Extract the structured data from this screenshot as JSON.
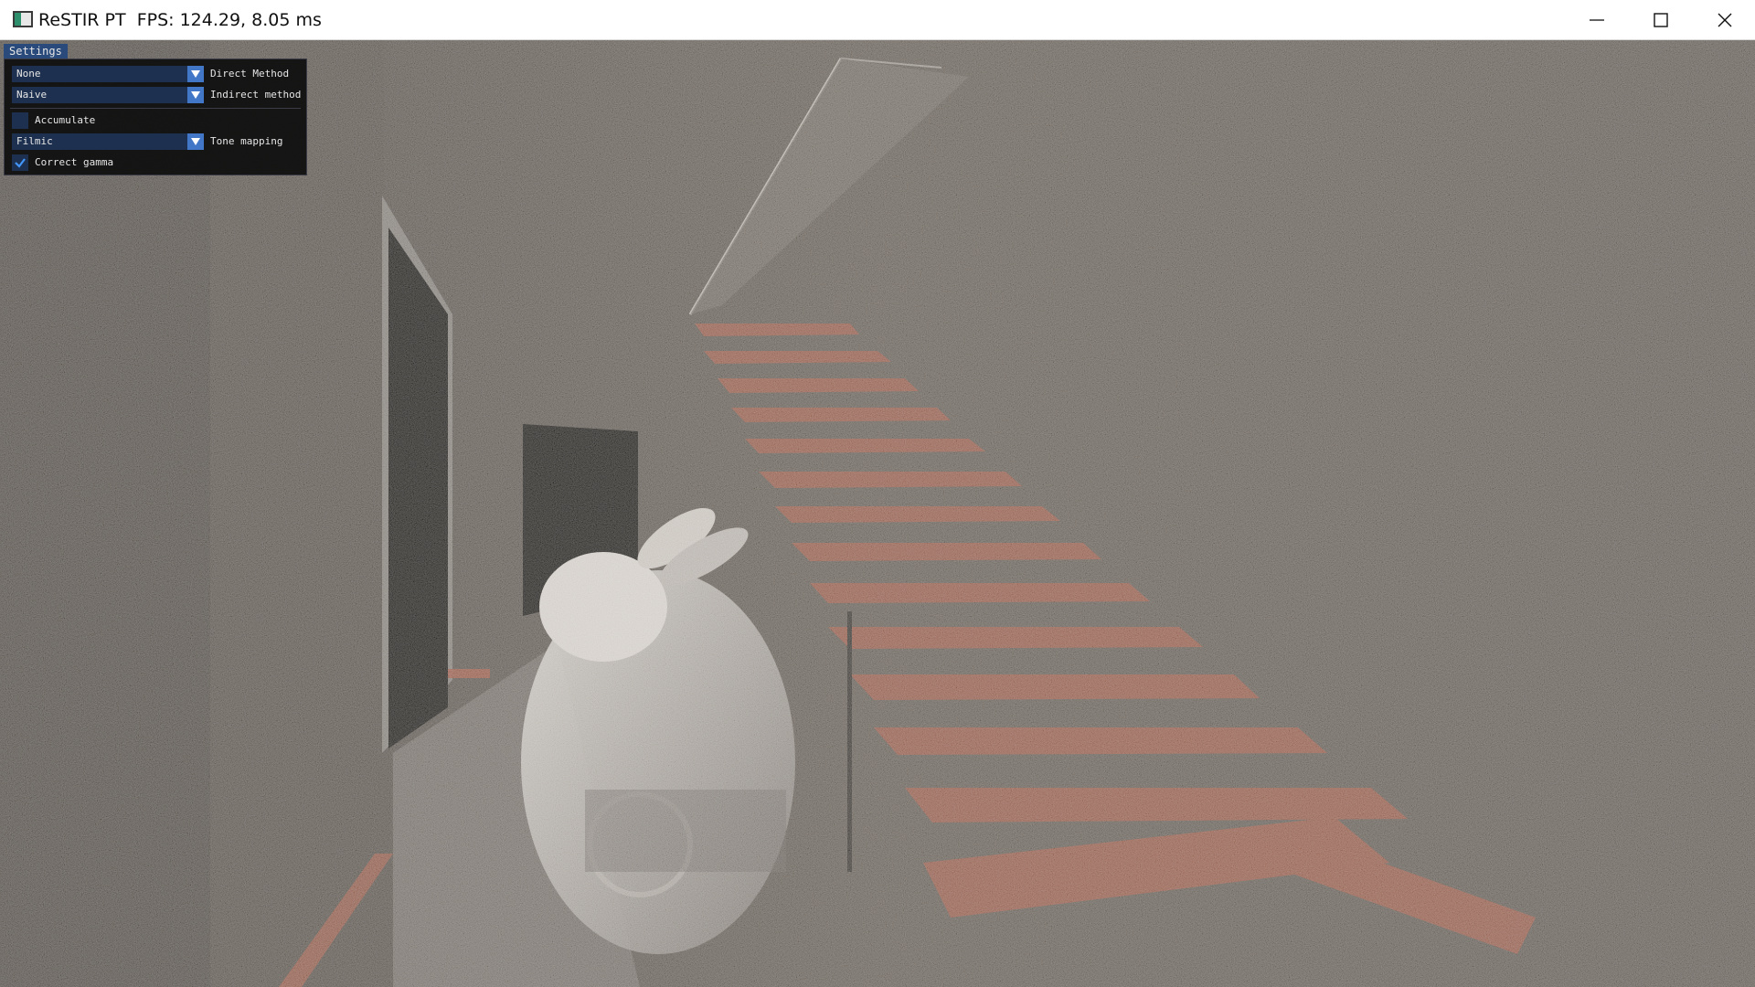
{
  "window": {
    "title": "ReSTIR PT  FPS: 124.29, 8.05 ms",
    "app_icon": "app-window-icon",
    "controls": [
      "minimize-icon",
      "maximize-icon",
      "close-icon"
    ]
  },
  "settings_panel": {
    "tab_label": "Settings",
    "direct_method": {
      "value": "None",
      "label": "Direct Method"
    },
    "indirect_method": {
      "value": "Naive",
      "label": "Indirect method"
    },
    "accumulate": {
      "label": "Accumulate",
      "checked": false
    },
    "tone_mapping": {
      "value": "Filmic",
      "label": "Tone mapping"
    },
    "correct_gamma": {
      "label": "Correct gamma",
      "checked": true
    }
  },
  "colors": {
    "imgui_frame": "#1d3050",
    "imgui_button": "#4276c6",
    "imgui_title": "#294a7a",
    "scene_wall": "#4b4540",
    "scene_stairs": "#8a4332"
  }
}
